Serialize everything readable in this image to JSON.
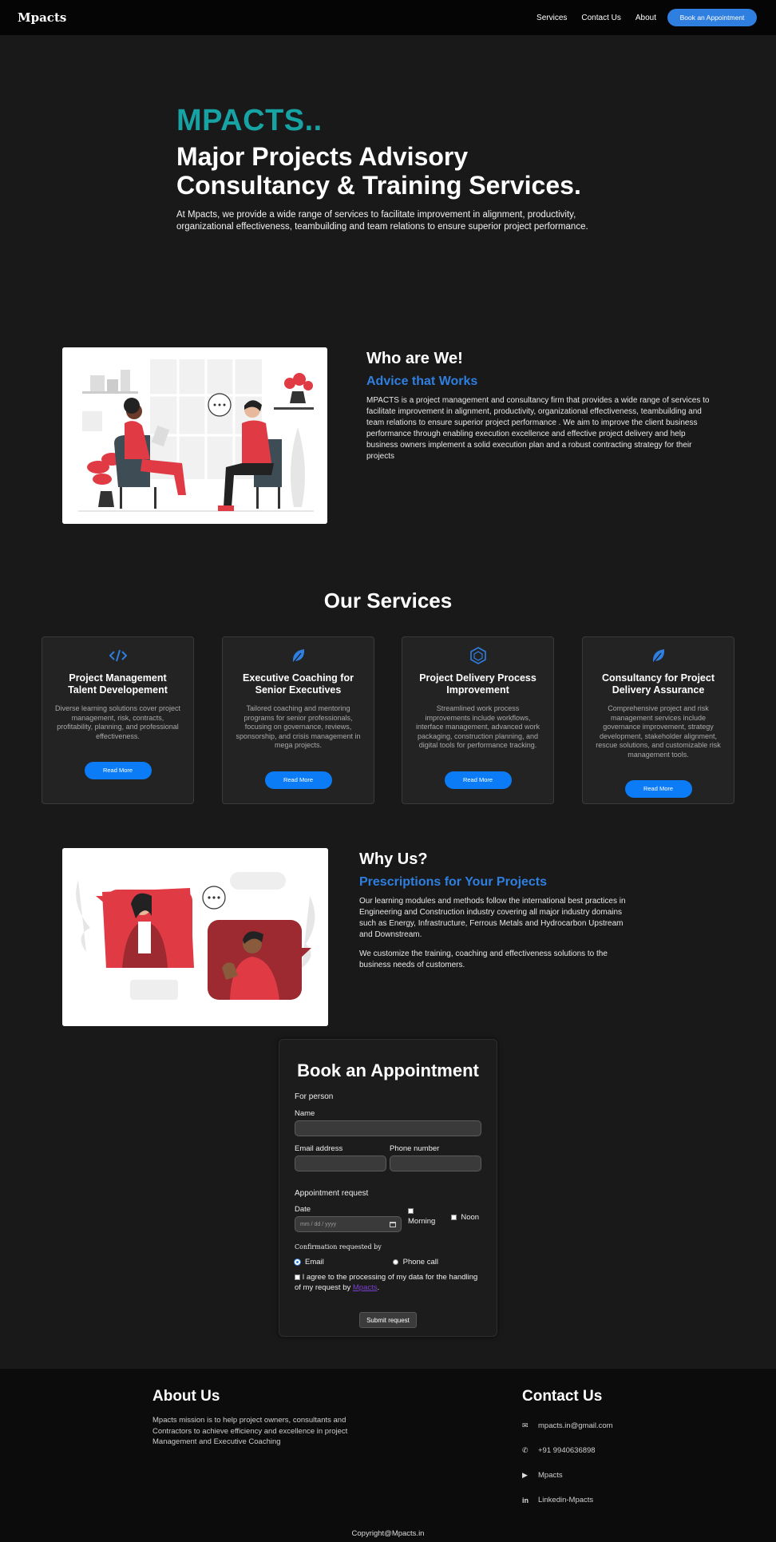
{
  "nav": {
    "brand": "Mpacts",
    "links": [
      "Services",
      "Contact Us",
      "About"
    ],
    "cta": "Book an Appointment"
  },
  "hero": {
    "brand": "MPACTS..",
    "title": "Major Projects Advisory Consultancy & Training Services.",
    "text": "At Mpacts, we provide a wide range of services to facilitate improvement in alignment, productivity, organizational effectiveness, teambuilding and team relations to ensure superior project performance."
  },
  "who": {
    "title": "Who are We!",
    "subtitle": "Advice that Works",
    "text": "MPACTS is a project management and consultancy firm that provides a wide range of services to facilitate improvement in alignment, productivity, organizational effectiveness, teambuilding and team relations to ensure superior project performance . We aim to improve the client business performance through enabling execution excellence and effective project delivery and help business owners implement a solid execution plan and a robust contracting strategy for their projects"
  },
  "services": {
    "title": "Our Services",
    "cards": [
      {
        "icon": "code-icon",
        "title": "Project Management Talent Developement",
        "text": "Diverse learning solutions cover project management, risk, contracts, profitability, planning, and professional effectiveness.",
        "button": "Read More"
      },
      {
        "icon": "leaf-icon",
        "title": "Executive Coaching for Senior Executives",
        "text": "Tailored coaching and mentoring programs for senior professionals, focusing on governance, reviews, sponsorship, and crisis management in mega projects.",
        "button": "Read More"
      },
      {
        "icon": "hexagon-icon",
        "title": "Project Delivery Process Improvement",
        "text": "Streamlined work process improvements include workflows, interface management, advanced work packaging, construction planning, and digital tools for performance tracking.",
        "button": "Read More"
      },
      {
        "icon": "leaf-icon",
        "title": "Consultancy for Project Delivery Assurance",
        "text": "Comprehensive project and risk management services include governance improvement, strategy development, stakeholder alignment, rescue solutions, and customizable risk management tools.",
        "button": "Read More"
      }
    ]
  },
  "why": {
    "title": "Why Us?",
    "subtitle": "Prescriptions for Your Projects",
    "text1": "Our learning modules and methods follow the international best practices in Engineering and Construction industry covering all major industry domains such as Energy, Infrastructure, Ferrous Metals and Hydrocarbon Upstream and Downstream.",
    "text2": "We customize the training, coaching and effectiveness solutions to the business needs of customers."
  },
  "form": {
    "title": "Book an Appointment",
    "for_person": "For person",
    "name_label": "Name",
    "email_label": "Email address",
    "phone_label": "Phone number",
    "request_label": "Appointment request",
    "date_label": "Date",
    "date_placeholder": "mm / dd / yyyy",
    "morning": "Morning",
    "noon": "Noon",
    "confirm_label": "Confirmation requested by",
    "opt_email": "Email",
    "opt_phone": "Phone call",
    "consent_prefix": "I agree to the processing of my data for the handling of my request by",
    "consent_link": "Mpacts",
    "submit": "Submit request"
  },
  "footer": {
    "about_title": "About Us",
    "about_text": "Mpacts mission is to help project owners, consultants and Contractors to achieve efficiency and excellence in project Management and Executive Coaching",
    "contact_title": "Contact Us",
    "contacts": [
      {
        "icon": "envelope-icon",
        "text": "mpacts.in@gmail.com"
      },
      {
        "icon": "phone-icon",
        "text": "+91 9940636898"
      },
      {
        "icon": "youtube-icon",
        "text": "Mpacts"
      },
      {
        "icon": "linkedin-icon",
        "text": "Linkedin-Mpacts"
      }
    ],
    "copyright": "Copyright@Mpacts.in"
  },
  "colors": {
    "accent": "#2f7fe0",
    "brand_teal": "#17a2a4",
    "background": "#191919",
    "button_blue": "#0b7cf5"
  }
}
